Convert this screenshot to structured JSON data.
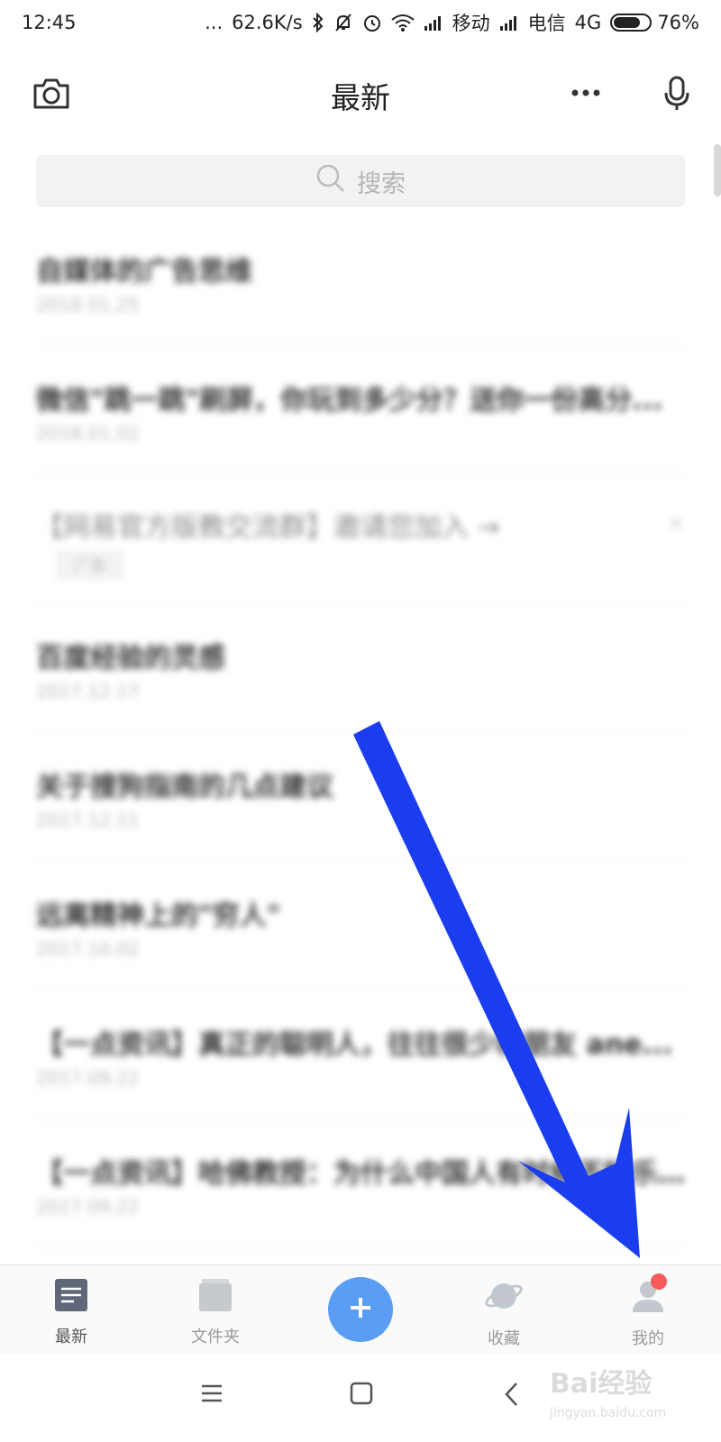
{
  "status_bar": {
    "time": "12:45",
    "dots": "...",
    "speed": "62.6K/s",
    "carrier1": "移动",
    "carrier2": "电信",
    "network": "4G",
    "battery_percent": "76%",
    "battery_level": 0.76
  },
  "header": {
    "title": "最新",
    "left_icon": "camera-icon",
    "right_icons": [
      "more-icon",
      "microphone-icon"
    ]
  },
  "search": {
    "placeholder": "搜索",
    "icon": "search-icon"
  },
  "notes": [
    {
      "title": "自媒体的广告思维",
      "date": "2018.01.25"
    },
    {
      "title": "微信\"跳一跳\"刷屏，你玩到多少分？送你一份高分...",
      "date": "2018.01.02"
    },
    {
      "title": "【网易官方版教交流群】邀请您加入 →",
      "tag": "广告",
      "close": "×",
      "ad": true
    },
    {
      "title": "百度经验的灵感",
      "date": "2017.12.17"
    },
    {
      "title": "关于搜狗指南的几点建议",
      "date": "2017.12.11"
    },
    {
      "title": "远离精神上的\"穷人\"",
      "date": "2017.10.02"
    },
    {
      "title": "【一点资讯】真正的聪明人，往往很少和朋友 ane...",
      "date": "2017.09.22"
    },
    {
      "title": "【一点资讯】哈佛教授：为什么中国人有时候不快乐...",
      "date": "2017.09.22"
    }
  ],
  "tabbar": {
    "items": [
      {
        "label": "最新",
        "icon": "note-icon",
        "active": true
      },
      {
        "label": "文件夹",
        "icon": "folder-icon",
        "active": false
      },
      {
        "label": "",
        "icon": "plus-icon",
        "active": false
      },
      {
        "label": "收藏",
        "icon": "planet-icon",
        "active": false
      },
      {
        "label": "我的",
        "icon": "user-icon",
        "active": false
      }
    ],
    "badge_on": "我的"
  },
  "system_nav": [
    "menu-icon",
    "home-icon",
    "back-icon"
  ],
  "watermark": {
    "logo_text": "Bai经验",
    "url": "jingyan.baidu.com"
  },
  "colors": {
    "accent": "#5a9df5",
    "arrow": "#1a3df0",
    "badge": "#f65a5a"
  }
}
